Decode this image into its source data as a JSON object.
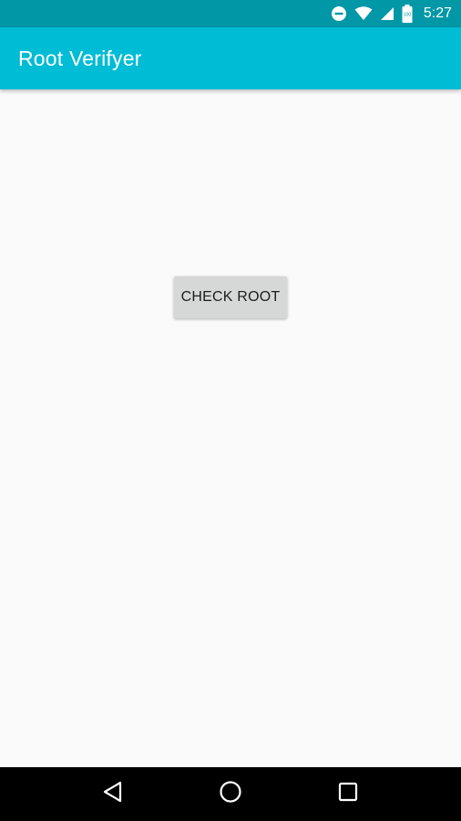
{
  "status_bar": {
    "time": "5:27",
    "battery_level": "100",
    "icons": [
      "do-not-disturb-icon",
      "wifi-icon",
      "cell-signal-icon",
      "battery-icon"
    ]
  },
  "app_bar": {
    "title": "Root Verifyer"
  },
  "main": {
    "check_button_label": "CHECK ROOT"
  },
  "nav_bar": {
    "buttons": [
      "back-icon",
      "home-icon",
      "recents-icon"
    ]
  },
  "colors": {
    "status_bar": "#0097a7",
    "app_bar": "#00bcd4",
    "background": "#fafafa",
    "button": "#d6d7d7"
  }
}
